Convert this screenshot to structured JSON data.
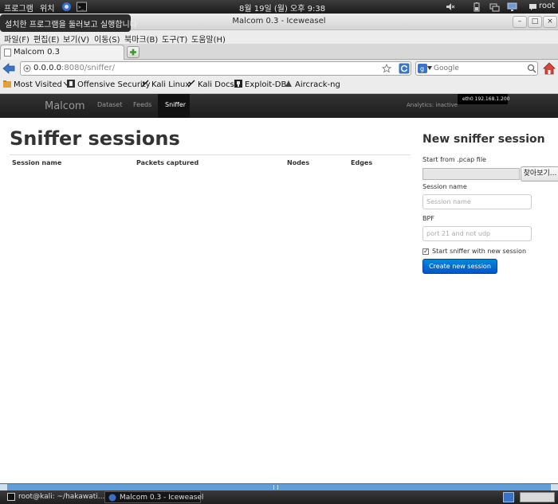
{
  "gnome_panel": {
    "applications": "프로그램",
    "places": "위치",
    "datetime": "8월 19일 (월) 오후 9:38",
    "user": "root"
  },
  "tooltip": "설치한 프로그램을 둘러보고 실행합니다",
  "window": {
    "title": "Malcom 0.3 - Iceweasel",
    "minimize": "–",
    "maximize": "□",
    "close": "×"
  },
  "menu": [
    "파일(F)",
    "편집(E)",
    "보기(V)",
    "이동(S)",
    "북마크(B)",
    "도구(T)",
    "도움말(H)"
  ],
  "tab": {
    "label": "Malcom 0.3"
  },
  "urlbar": {
    "host": "0.0.0.0",
    "path": ":8080/sniffer/"
  },
  "search": {
    "placeholder": "Google"
  },
  "bookmarks": [
    "Most Visited",
    "Offensive Security",
    "Kali Linux",
    "Kali Docs",
    "Exploit-DB",
    "Aircrack-ng"
  ],
  "app_nav": {
    "brand": "Malcom",
    "links": [
      "Dataset",
      "Feeds",
      "Sniffer"
    ],
    "analytics": "Analytics: inactive",
    "iface": "eth0 192.168.1.200"
  },
  "main": {
    "title": "Sniffer sessions",
    "columns": [
      "Session name",
      "Packets captured",
      "Nodes",
      "Edges"
    ]
  },
  "sidebar": {
    "title": "New sniffer session",
    "pcap_label": "Start from .pcap file",
    "browse_label": "찾아보기...",
    "session_label": "Session name",
    "session_placeholder": "Session name",
    "bpf_label": "BPF",
    "bpf_placeholder": "port 21 and not udp",
    "start_label": "Start sniffer with new session",
    "start_checked": true,
    "create_label": "Create new session"
  },
  "taskbar": {
    "terminal": "root@kali: ~/hakawati...",
    "browser": "Malcom 0.3 - Iceweasel"
  }
}
